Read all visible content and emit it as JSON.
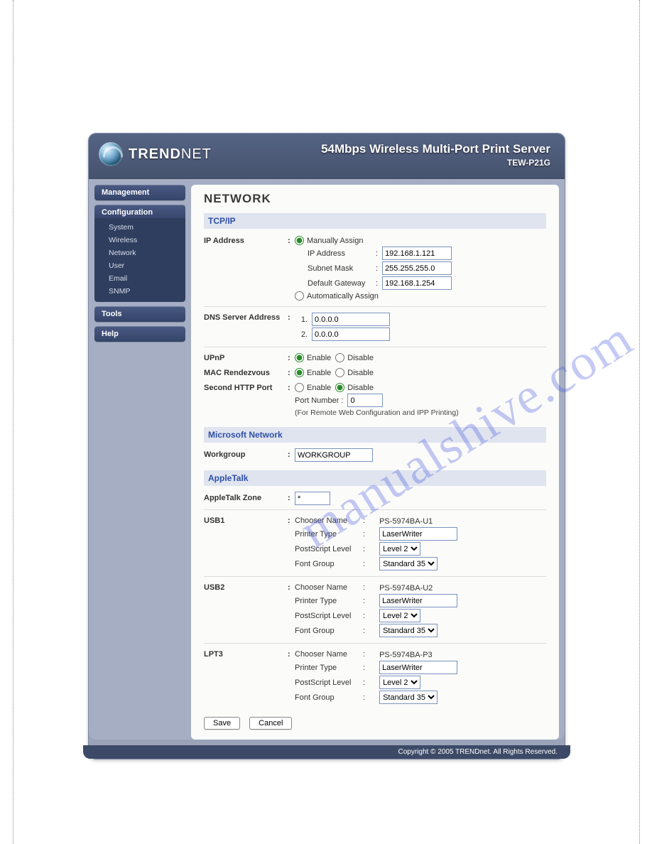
{
  "watermark": "manualshive.com",
  "brand": {
    "name_bold": "TREND",
    "name_thin": "NET"
  },
  "header": {
    "title": "54Mbps Wireless Multi-Port Print Server",
    "model": "TEW-P21G"
  },
  "sidebar": {
    "groups": [
      {
        "title": "Management",
        "items": []
      },
      {
        "title": "Configuration",
        "items": [
          "System",
          "Wireless",
          "Network",
          "User",
          "Email",
          "SNMP"
        ]
      },
      {
        "title": "Tools",
        "items": []
      },
      {
        "title": "Help",
        "items": []
      }
    ]
  },
  "page_title": "NETWORK",
  "sections": {
    "tcpip": {
      "title": "TCP/IP",
      "ip_address_label": "IP Address",
      "manual_label": "Manually Assign",
      "manual_selected": true,
      "ip_label": "IP Address",
      "ip_value": "192.168.1.121",
      "subnet_label": "Subnet Mask",
      "subnet_value": "255.255.255.0",
      "gateway_label": "Default Gateway",
      "gateway_value": "192.168.1.254",
      "auto_label": "Automatically Assign",
      "dns_label": "DNS Server Address",
      "dns1_label": "1.",
      "dns1_value": "0.0.0.0",
      "dns2_label": "2.",
      "dns2_value": "0.0.0.0",
      "upnp_label": "UPnP",
      "upnp_value": "enable",
      "mac_label": "MAC Rendezvous",
      "mac_value": "enable",
      "http_label": "Second HTTP Port",
      "http_value": "disable",
      "port_number_label": "Port Number :",
      "port_number_value": "0",
      "http_note": "(For Remote Web Configuration and IPP Printing)",
      "enable": "Enable",
      "disable": "Disable"
    },
    "msnet": {
      "title": "Microsoft Network",
      "workgroup_label": "Workgroup",
      "workgroup_value": "WORKGROUP"
    },
    "appletalk": {
      "title": "AppleTalk",
      "zone_label": "AppleTalk Zone",
      "zone_value": "*",
      "chooser_label": "Chooser Name",
      "printer_type_label": "Printer Type",
      "ps_level_label": "PostScript Level",
      "font_group_label": "Font Group",
      "level_options": [
        "Level 2"
      ],
      "font_options": [
        "Standard 35"
      ],
      "ports": [
        {
          "name": "USB1",
          "chooser": "PS-5974BA-U1",
          "printer_type": "LaserWriter",
          "level": "Level 2",
          "font": "Standard 35"
        },
        {
          "name": "USB2",
          "chooser": "PS-5974BA-U2",
          "printer_type": "LaserWriter",
          "level": "Level 2",
          "font": "Standard 35"
        },
        {
          "name": "LPT3",
          "chooser": "PS-5974BA-P3",
          "printer_type": "LaserWriter",
          "level": "Level 2",
          "font": "Standard 35"
        }
      ]
    }
  },
  "buttons": {
    "save": "Save",
    "cancel": "Cancel"
  },
  "footer": "Copyright © 2005 TRENDnet. All Rights Reserved."
}
